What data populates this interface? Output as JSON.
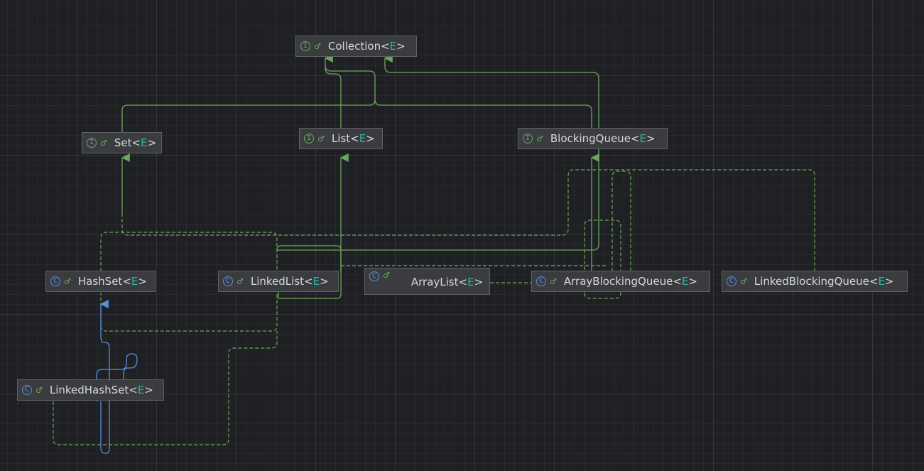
{
  "diagram": {
    "nodes": [
      {
        "id": "collection",
        "kind": "interface",
        "badge": "I",
        "vis_icon": "unlock-icon",
        "name": "Collection",
        "type_param": "E"
      },
      {
        "id": "set",
        "kind": "interface",
        "badge": "I",
        "vis_icon": "unlock-icon",
        "name": "Set",
        "type_param": "E"
      },
      {
        "id": "list",
        "kind": "interface",
        "badge": "I",
        "vis_icon": "unlock-icon",
        "name": "List",
        "type_param": "E"
      },
      {
        "id": "blockingqueue",
        "kind": "interface",
        "badge": "I",
        "vis_icon": "unlock-icon",
        "name": "BlockingQueue",
        "type_param": "E"
      },
      {
        "id": "hashset",
        "kind": "class",
        "badge": "C",
        "vis_icon": "unlock-icon",
        "name": "HashSet",
        "type_param": "E"
      },
      {
        "id": "linkedlist",
        "kind": "class",
        "badge": "C",
        "vis_icon": "unlock-icon",
        "name": "LinkedList",
        "type_param": "E"
      },
      {
        "id": "arraylist",
        "kind": "class",
        "badge": "C",
        "vis_icon": "unlock-icon",
        "name": "ArrayList",
        "type_param": "E"
      },
      {
        "id": "arrayblockingqueue",
        "kind": "class",
        "badge": "C",
        "vis_icon": "unlock-icon",
        "name": "ArrayBlockingQueue",
        "type_param": "E"
      },
      {
        "id": "linkedblockingqueue",
        "kind": "class",
        "badge": "C",
        "vis_icon": "unlock-icon",
        "name": "LinkedBlockingQueue",
        "type_param": "E"
      },
      {
        "id": "linkedhashset",
        "kind": "class",
        "badge": "C",
        "vis_icon": "unlock-icon",
        "name": "LinkedHashSet",
        "type_param": "E"
      }
    ],
    "edges": [
      {
        "from": "set",
        "to": "collection",
        "type": "extends"
      },
      {
        "from": "list",
        "to": "collection",
        "type": "extends"
      },
      {
        "from": "blockingqueue",
        "to": "collection",
        "type": "extends"
      },
      {
        "from": "hashset",
        "to": "set",
        "type": "implements"
      },
      {
        "from": "linkedhashset",
        "to": "set",
        "type": "implements"
      },
      {
        "from": "linkedlist",
        "to": "list",
        "type": "implements"
      },
      {
        "from": "arraylist",
        "to": "list",
        "type": "implements"
      },
      {
        "from": "arrayblockingqueue",
        "to": "blockingqueue",
        "type": "implements"
      },
      {
        "from": "linkedblockingqueue",
        "to": "blockingqueue",
        "type": "implements"
      },
      {
        "from": "linkedhashset",
        "to": "hashset",
        "type": "class-extends"
      }
    ],
    "colors": {
      "canvas": "#1f2023",
      "node_fill": "#3a3c40",
      "node_border": "#5f6166",
      "text": "#d6d8dc",
      "type_param": "#2bb5a6",
      "interface_edge": "#6ba65c",
      "class_extends_edge": "#5a8fe0"
    }
  }
}
